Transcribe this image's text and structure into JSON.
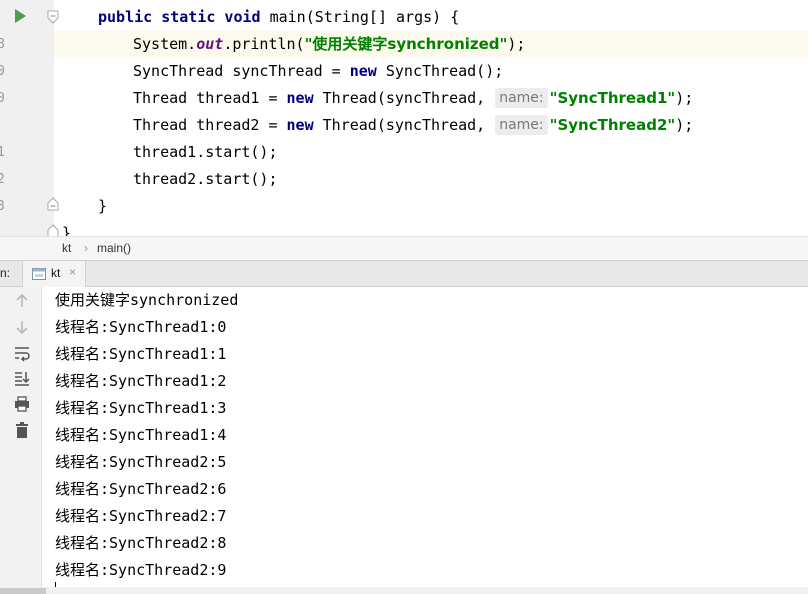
{
  "editor": {
    "gutter_numbers": [
      "8",
      "0",
      "0",
      "1",
      "2",
      "3"
    ],
    "lines": {
      "main_sig": {
        "kw": "public static void",
        "rest": " main(String[] args) {"
      },
      "println": {
        "pre": "System.",
        "field": "out",
        "mid": ".println(",
        "str": "\"使用关键字synchronized\"",
        "end": ");"
      },
      "sync": {
        "pre": "SyncThread syncThread = ",
        "kw": "new",
        "end": " SyncThread();"
      },
      "t1": {
        "pre": "Thread thread1 = ",
        "kw": "new",
        "mid": " Thread(syncThread,",
        "hint": "name:",
        "str": "\"SyncThread1\"",
        "end": ");"
      },
      "t2": {
        "pre": "Thread thread2 = ",
        "kw": "new",
        "mid": " Thread(syncThread,",
        "hint": "name:",
        "str": "\"SyncThread2\"",
        "end": ");"
      },
      "start1": "thread1.start();",
      "start2": "thread2.start();",
      "close_method": "}",
      "close_class": "}"
    }
  },
  "breadcrumb": {
    "items": [
      "kt",
      "main()"
    ],
    "separator": "›"
  },
  "run_panel": {
    "label": "n:",
    "tab": {
      "label": "kt",
      "close": "×"
    }
  },
  "console": {
    "icons": [
      "up-arrow-icon",
      "down-arrow-icon",
      "soft-wrap-icon",
      "scroll-to-end-icon",
      "print-icon",
      "trash-icon"
    ],
    "output": [
      "使用关键字synchronized",
      "线程名:SyncThread1:0",
      "线程名:SyncThread1:1",
      "线程名:SyncThread1:2",
      "线程名:SyncThread1:3",
      "线程名:SyncThread1:4",
      "线程名:SyncThread2:5",
      "线程名:SyncThread2:6",
      "线程名:SyncThread2:7",
      "线程名:SyncThread2:8",
      "线程名:SyncThread2:9"
    ]
  },
  "colors": {
    "keyword": "#000080",
    "string": "#008000",
    "field": "#660e7a",
    "run": "#4e9a4e"
  }
}
